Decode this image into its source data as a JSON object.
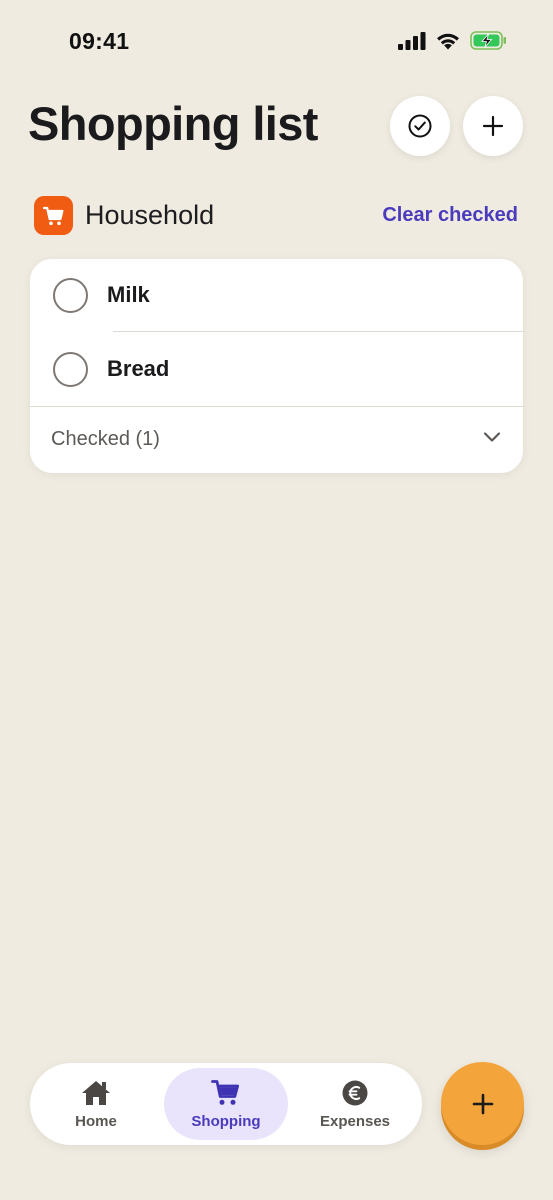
{
  "status_bar": {
    "time": "09:41",
    "icons": [
      "cellular-signal-icon",
      "wifi-icon",
      "battery-charging-icon"
    ]
  },
  "header": {
    "title": "Shopping list",
    "buttons": [
      "check-circle-icon",
      "plus-icon"
    ]
  },
  "section": {
    "icon": "shopping-cart-icon",
    "title": "Household",
    "clear_label": "Clear checked"
  },
  "list": {
    "items": [
      {
        "label": "Milk",
        "checked": false
      },
      {
        "label": "Bread",
        "checked": false
      }
    ],
    "checked_label": "Checked (1)",
    "checked_collapsed": true
  },
  "tab_bar": {
    "tabs": [
      {
        "label": "Home",
        "icon": "home-icon",
        "active": false
      },
      {
        "label": "Shopping",
        "icon": "shopping-cart-icon",
        "active": true
      },
      {
        "label": "Expenses",
        "icon": "euro-icon",
        "active": false
      }
    ],
    "fab_icon": "plus-icon"
  },
  "colors": {
    "background": "#efebe1",
    "accent": "#4a3bbd",
    "section_icon": "#ef5c12",
    "fab": "#f3a43b",
    "active_tab": "#e9e4fb"
  }
}
